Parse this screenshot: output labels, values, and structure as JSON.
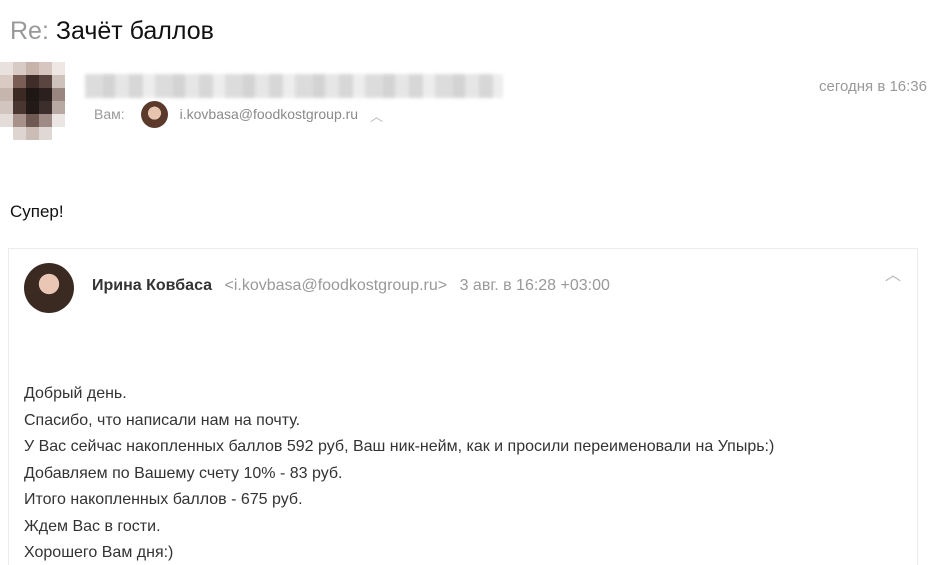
{
  "email": {
    "subject_prefix": "Re:",
    "subject": "Зачёт баллов",
    "date": "сегодня в 16:36",
    "to_label": "Вам:",
    "to_email": "i.kovbasa@foodkostgroup.ru",
    "reply_text": "Супер!"
  },
  "quote": {
    "sender_name": "Ирина Ковбаса",
    "sender_email": "<i.kovbasa@foodkostgroup.ru>",
    "date": "3 авг. в 16:28 +03:00",
    "lines": [
      "Добрый день.",
      "Спасибо, что написали нам на почту.",
      "У Вас сейчас накопленных баллов 592 руб, Ваш ник-нейм, как и просили переименовали на Упырь:)",
      "Добавляем по Вашему счету 10% - 83 руб.",
      "Итого накопленных баллов - 675 руб.",
      "Ждем Вас в гости.",
      "Хорошего Вам дня:)"
    ]
  },
  "icons": {
    "collapse": "chevron-up-icon",
    "recipients_toggle": "chevron-up-icon"
  }
}
